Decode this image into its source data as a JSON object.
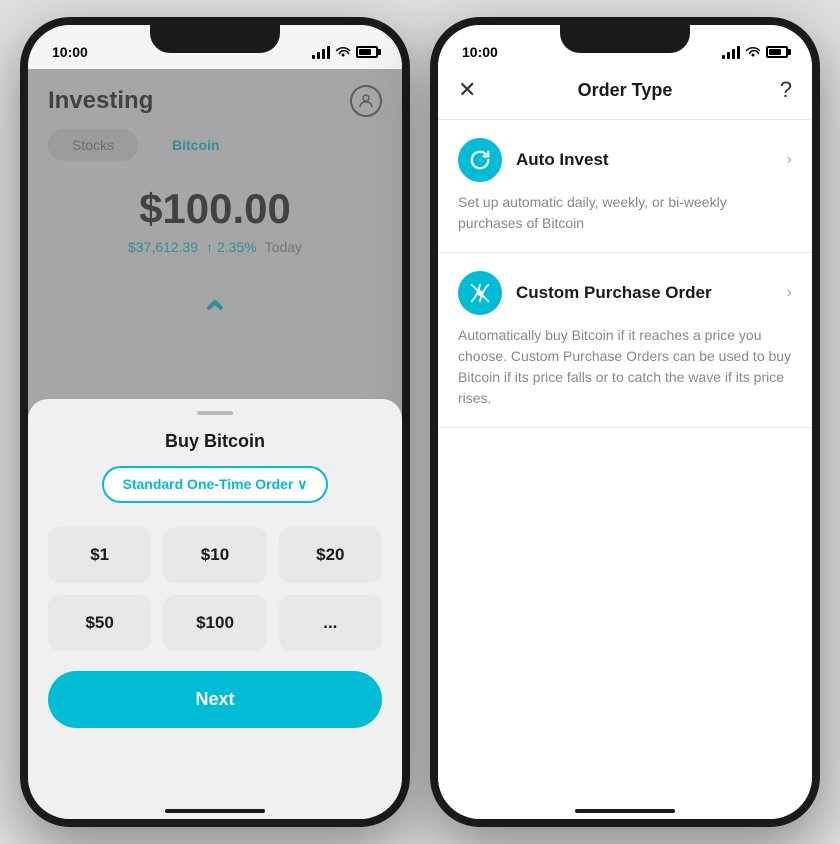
{
  "left_phone": {
    "status": {
      "time": "10:00"
    },
    "header": {
      "title": "Investing",
      "profile_label": "profile"
    },
    "tabs": [
      {
        "label": "Stocks",
        "active": false
      },
      {
        "label": "Bitcoin",
        "active": true
      }
    ],
    "price": {
      "main": "$100.00",
      "btc": "$37,612.39",
      "change": "↑ 2.35%",
      "period": "Today"
    },
    "chart_logo": "⌃",
    "bottom_sheet": {
      "title": "Buy Bitcoin",
      "order_type": "Standard One-Time Order ∨",
      "amounts": [
        "$1",
        "$10",
        "$20",
        "$50",
        "$100",
        "..."
      ],
      "next_label": "Next"
    }
  },
  "right_phone": {
    "status": {
      "time": "10:00"
    },
    "header": {
      "close": "✕",
      "title": "Order Type",
      "help": "?"
    },
    "options": [
      {
        "name": "Auto Invest",
        "icon": "↺",
        "description": "Set up automatic daily, weekly, or bi-weekly purchases of Bitcoin"
      },
      {
        "name": "Custom Purchase Order",
        "icon": "⟳",
        "description": "Automatically buy Bitcoin if it reaches a price you choose. Custom Purchase Orders can be used to buy Bitcoin if its price falls or to catch the wave if its price rises."
      }
    ]
  }
}
